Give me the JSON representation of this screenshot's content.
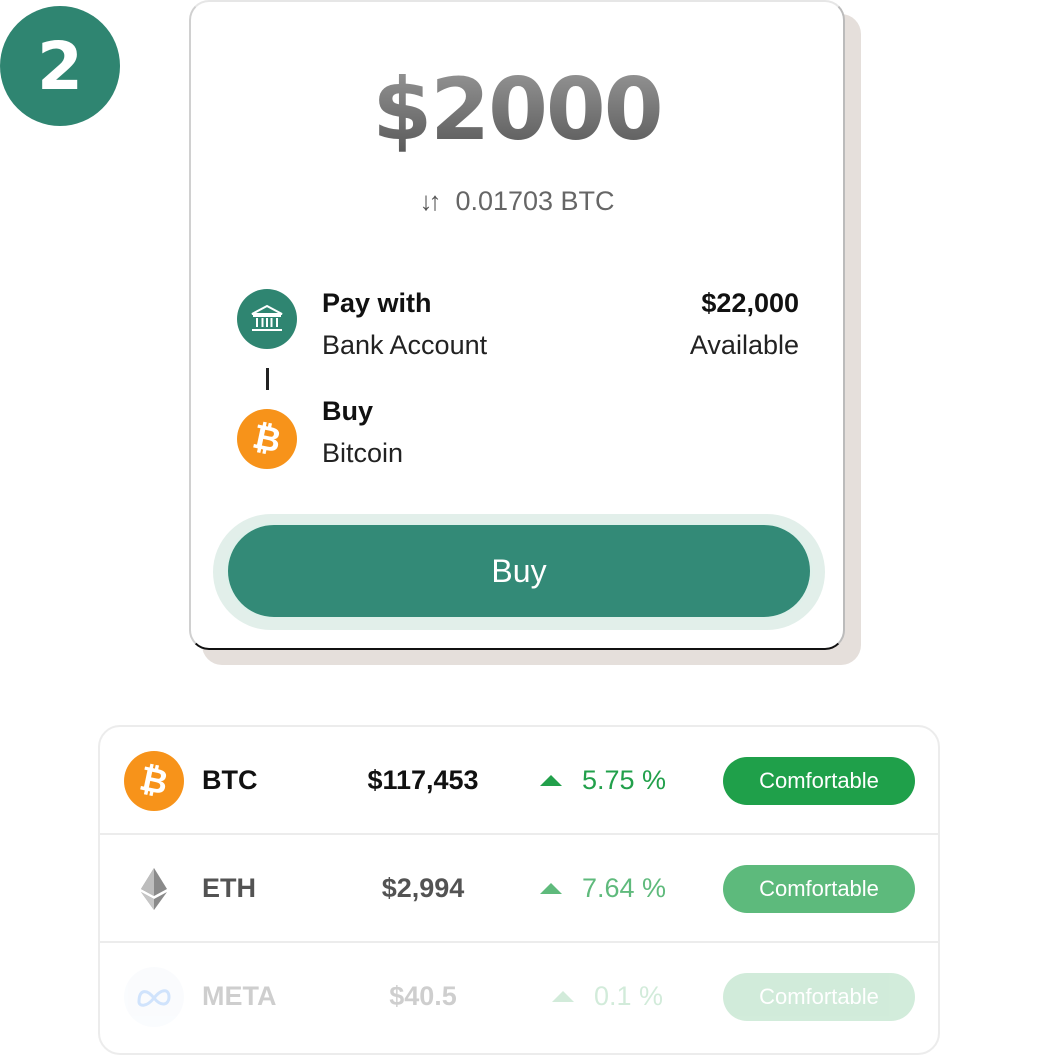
{
  "step": {
    "number": "2"
  },
  "order": {
    "amount": "$2000",
    "conversion": "0.01703 BTC",
    "pay": {
      "title": "Pay with",
      "method": "Bank Account",
      "balance": "$22,000",
      "balance_label": "Available"
    },
    "buy": {
      "title": "Buy",
      "asset": "Bitcoin"
    },
    "button_label": "Buy"
  },
  "assets": [
    {
      "symbol": "BTC",
      "price": "$117,453",
      "change": "5.75 %",
      "badge": "Comfortable",
      "icon": "bitcoin-icon"
    },
    {
      "symbol": "ETH",
      "price": "$2,994",
      "change": "7.64 %",
      "badge": "Comfortable",
      "icon": "ethereum-icon"
    },
    {
      "symbol": "META",
      "price": "$40.5",
      "change": "0.1 %",
      "badge": "Comfortable",
      "icon": "meta-icon"
    }
  ],
  "colors": {
    "brand_green": "#2f8571",
    "bitcoin_orange": "#f7931a",
    "positive_green": "#22a04b"
  }
}
